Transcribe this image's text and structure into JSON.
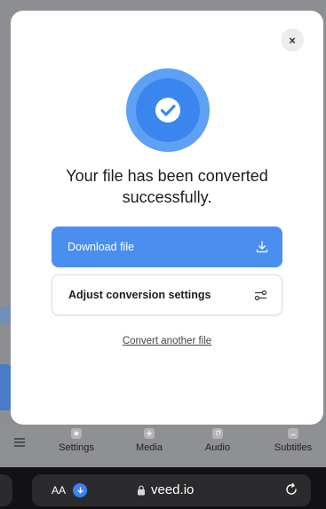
{
  "modal": {
    "close_label": "×",
    "headline": "Your file has been converted successfully.",
    "download_label": "Download file",
    "adjust_label": "Adjust conversion settings",
    "convert_link": "Convert another file"
  },
  "toolbar": {
    "items": [
      {
        "label": "Settings",
        "icon": "gear-icon"
      },
      {
        "label": "Media",
        "icon": "media-icon"
      },
      {
        "label": "Audio",
        "icon": "music-icon"
      },
      {
        "label": "Subtitles",
        "icon": "subtitles-icon"
      }
    ]
  },
  "browser": {
    "aa_label": "AA",
    "url": "veed.io"
  },
  "colors": {
    "accent": "#4a8ff0",
    "success": "#3b86ee"
  }
}
